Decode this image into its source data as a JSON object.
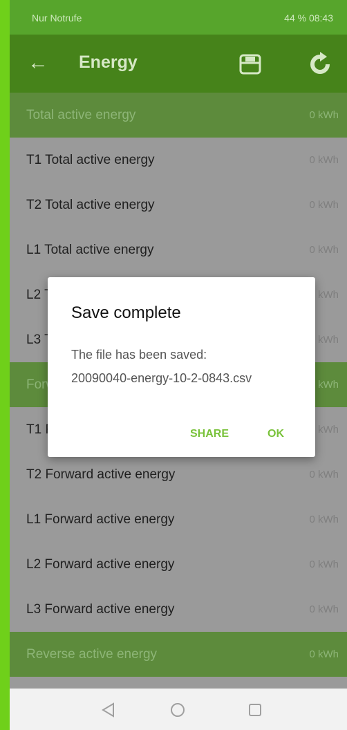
{
  "status_bar": {
    "left_text": "Nur Notrufe",
    "right_text": "44 %  08:43"
  },
  "app_bar": {
    "title": "Energy",
    "back_icon": "arrow-left-icon",
    "save_icon": "save-icon",
    "refresh_icon": "refresh-icon"
  },
  "rows": [
    {
      "label": "Total active energy",
      "value": "0 kWh",
      "section": true
    },
    {
      "label": "T1 Total active energy",
      "value": "0 kWh",
      "section": false
    },
    {
      "label": "T2 Total active energy",
      "value": "0 kWh",
      "section": false
    },
    {
      "label": "L1 Total active energy",
      "value": "0 kWh",
      "section": false
    },
    {
      "label": "L2 Total active energy",
      "value": "0 kWh",
      "section": false
    },
    {
      "label": "L3 Total active energy",
      "value": "0 kWh",
      "section": false
    },
    {
      "label": "Forward active energy",
      "value": "0 kWh",
      "section": true
    },
    {
      "label": "T1 Forward active energy",
      "value": "0 kWh",
      "section": false
    },
    {
      "label": "T2 Forward active energy",
      "value": "0 kWh",
      "section": false
    },
    {
      "label": "L1 Forward active energy",
      "value": "0 kWh",
      "section": false
    },
    {
      "label": "L2 Forward active energy",
      "value": "0 kWh",
      "section": false
    },
    {
      "label": "L3 Forward active energy",
      "value": "0 kWh",
      "section": false
    },
    {
      "label": "Reverse active energy",
      "value": "0 kWh",
      "section": true
    }
  ],
  "dialog": {
    "title": "Save complete",
    "message_line1": "The file has been saved:",
    "message_line2": "20090040-energy-10-2-0843.csv",
    "share_label": "SHARE",
    "ok_label": "OK"
  },
  "nav_bar": {
    "back_icon": "triangle-back-icon",
    "home_icon": "circle-home-icon",
    "recents_icon": "square-recents-icon"
  },
  "colors": {
    "app_bar": "#46831a",
    "status_bar": "#57a52c",
    "accent": "#79c23a",
    "section": "#5d8b3c"
  }
}
